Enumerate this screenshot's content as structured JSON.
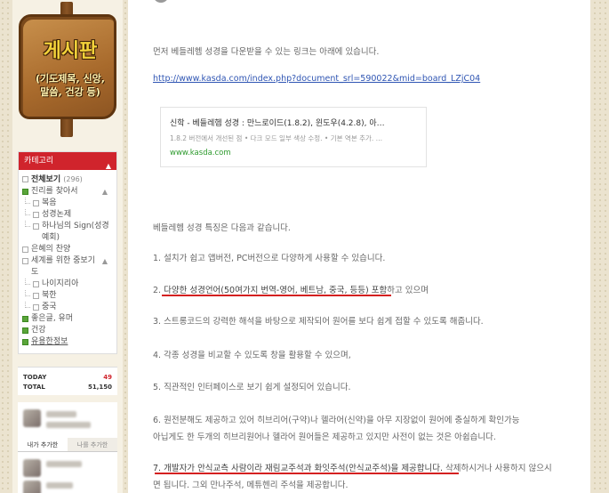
{
  "sidebar": {
    "sign": {
      "title": "게시판",
      "subtitle_line1": "(기도제목, 신앙,",
      "subtitle_line2": "말씀, 건강 등)"
    },
    "category": {
      "header": "카테고리",
      "items": [
        {
          "label": "전체보기",
          "count": "(296)",
          "bold": true
        },
        {
          "label": "진리를 찾아서",
          "green": true,
          "toggle": "▲"
        },
        {
          "label": "복음",
          "sub": true
        },
        {
          "label": "성경논제",
          "sub": true
        },
        {
          "label": "하나님의 Sign(성경",
          "sub": true
        },
        {
          "label": "예회)",
          "sub": true,
          "cont": true
        },
        {
          "label": "은혜의 찬양"
        },
        {
          "label": "세계를 위한 중보기",
          "toggle": "▲"
        },
        {
          "label": "도",
          "cont": true
        },
        {
          "label": "나이지리아",
          "sub": true
        },
        {
          "label": "북한",
          "sub": true
        },
        {
          "label": "중국",
          "sub": true
        },
        {
          "label": "좋은글, 유머",
          "green": true
        },
        {
          "label": "건강",
          "green": true
        },
        {
          "label": "유용한정보",
          "green": true,
          "underline": true
        }
      ]
    },
    "visits": {
      "today_label": "TODAY",
      "today_value": "49",
      "total_label": "TOTAL",
      "total_value": "51,150"
    },
    "neighbors": {
      "tab_active": "내가 추가한",
      "tab_inactive": "나를 추가한"
    }
  },
  "post": {
    "intro": "먼저 베들레헴 성경을 다운받을 수 있는 링크는 아래에 있습니다.",
    "link": "http://www.kasda.com/index.php?document_srl=590022&mid=board_LZjC04",
    "card": {
      "title": "신학 - 베들레헴 성경 : 만느로이드(1.8.2), 윈도우(4.2.8), 아…",
      "desc": "1.8.2 버전에서 개선된 점 • 다크 모드 일부 색상 수정. • 기본 역본 추가. …",
      "url": "www.kasda.com"
    },
    "features_intro": "베들레헴 성경 특징은 다음과 같습니다.",
    "f1": "1. 설치가 쉽고 앱버전, PC버전으로 다양하게 사용할 수 있습니다.",
    "f2_prefix": "2. ",
    "f2_highlight": "다양한 성경언어(50여가지 번역-영어, 베트남, 중국, 등등) 포함",
    "f2_suffix": "하고 있으며",
    "f3": "3. 스트롱코드의 강력한 해석을 바탕으로 제작되어 원어를 보다 쉽게 접할 수 있도록 해줍니다.",
    "f4": "4. 각종 성경을 비교할 수 있도록 창을 활용할 수 있으며,",
    "f5": "5. 직관적인 인터페이스로 보기 쉽게 설정되어 있습니다.",
    "f6_line1": "6. 원전분해도 제공하고 있어 히브리어(구약)나 헬라어(신약)을 아무 지장없이 원어에 충실하게 확인가능",
    "f6_line2": "아닙게도 한 두개의 히브리원어나 헬라어 원어들은 제공하고 있지만 사전이 없는 것은 아쉽습니다.",
    "f7_highlight": "7. 개발자가 안식교측 사람이라 재림교주석과 화잇주석(안식교주석)을 제공합니다.",
    "f7_suffix": " 삭제하시거나 사용하지 않으시",
    "f7_line2": "면 됩니다. 그외 만나주석, 메튜헨리 주석을 제공합니다."
  },
  "colors": {
    "accent_red": "#d0242c",
    "link_blue": "#2f55b3",
    "url_green": "#2d9a2d",
    "underline_red": "#d42020"
  }
}
